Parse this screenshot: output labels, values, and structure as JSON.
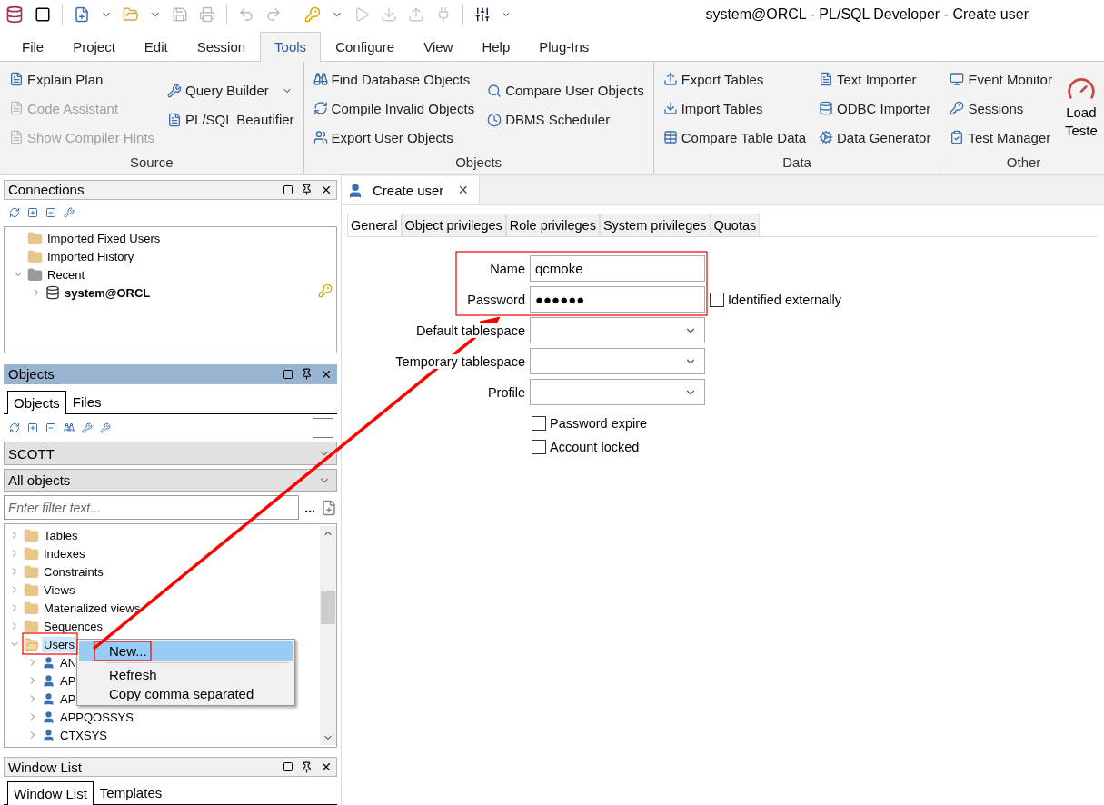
{
  "window": {
    "title": "system@ORCL - PL/SQL Developer - Create user"
  },
  "menu": [
    {
      "label": "File",
      "selected": false
    },
    {
      "label": "Project",
      "selected": false
    },
    {
      "label": "Edit",
      "selected": false
    },
    {
      "label": "Session",
      "selected": false
    },
    {
      "label": "Tools",
      "selected": true
    },
    {
      "label": "Configure",
      "selected": false
    },
    {
      "label": "View",
      "selected": false
    },
    {
      "label": "Help",
      "selected": false
    },
    {
      "label": "Plug-Ins",
      "selected": false
    }
  ],
  "ribbon": [
    {
      "title": "Source",
      "columns": [
        [
          {
            "label": "Explain Plan",
            "disabled": false
          },
          {
            "label": "Code Assistant",
            "disabled": true
          },
          {
            "label": "Show Compiler Hints",
            "disabled": true
          }
        ],
        [
          {
            "label": "Query Builder",
            "disabled": false,
            "dropdown": true
          },
          {
            "label": "PL/SQL Beautifier",
            "disabled": false
          }
        ]
      ]
    },
    {
      "title": "Objects",
      "columns": [
        [
          {
            "label": "Find Database Objects",
            "disabled": false
          },
          {
            "label": "Compile Invalid Objects",
            "disabled": false
          },
          {
            "label": "Export User Objects",
            "disabled": false
          }
        ],
        [
          {
            "label": "Compare User Objects",
            "disabled": false
          },
          {
            "label": "DBMS Scheduler",
            "disabled": false
          }
        ]
      ]
    },
    {
      "title": "Data",
      "columns": [
        [
          {
            "label": "Export Tables",
            "disabled": false
          },
          {
            "label": "Import Tables",
            "disabled": false
          },
          {
            "label": "Compare Table Data",
            "disabled": false
          }
        ],
        [
          {
            "label": "Text Importer",
            "disabled": false
          },
          {
            "label": "ODBC Importer",
            "disabled": false
          },
          {
            "label": "Data Generator",
            "disabled": false
          }
        ]
      ]
    },
    {
      "title": "Other",
      "columns": [
        [
          {
            "label": "Event Monitor",
            "disabled": false
          },
          {
            "label": "Sessions",
            "disabled": false
          },
          {
            "label": "Test Manager",
            "disabled": false
          }
        ]
      ],
      "large": {
        "lines": [
          "Load",
          "Teste"
        ]
      }
    }
  ],
  "connections": {
    "title": "Connections",
    "tree": [
      {
        "label": "Imported Fixed Users",
        "kind": "folder"
      },
      {
        "label": "Imported History",
        "kind": "folder"
      },
      {
        "label": "Recent",
        "kind": "group",
        "expanded": true,
        "children": [
          {
            "label": "system@ORCL",
            "kind": "connection",
            "expanded": false,
            "current": true
          }
        ]
      }
    ]
  },
  "objects": {
    "title": "Objects",
    "tabs": [
      {
        "label": "Objects",
        "selected": true
      },
      {
        "label": "Files",
        "selected": false
      }
    ],
    "schema": "SCOTT",
    "filter": "All objects",
    "search": {
      "placeholder": "Enter filter text..."
    },
    "more": "...",
    "tree": [
      {
        "label": "Tables",
        "expanded": false,
        "selected": false
      },
      {
        "label": "Indexes",
        "expanded": false,
        "selected": false
      },
      {
        "label": "Constraints",
        "expanded": false,
        "selected": false
      },
      {
        "label": "Views",
        "expanded": false,
        "selected": false
      },
      {
        "label": "Materialized views",
        "expanded": false,
        "selected": false
      },
      {
        "label": "Sequences",
        "expanded": false,
        "selected": false
      },
      {
        "label": "Users",
        "expanded": true,
        "selected": true,
        "children": [
          {
            "label": "AN",
            "expanded": false,
            "selected": false
          },
          {
            "label": "AP",
            "expanded": false,
            "selected": false
          },
          {
            "label": "AP",
            "expanded": false,
            "selected": false
          },
          {
            "label": "APPQOSSYS",
            "expanded": false,
            "selected": false
          },
          {
            "label": "CTXSYS",
            "expanded": false,
            "selected": false
          }
        ]
      }
    ]
  },
  "context_menu": [
    {
      "label": "New...",
      "selected": true
    },
    {
      "label": "Refresh",
      "selected": false
    },
    {
      "label": "Copy comma separated",
      "selected": false
    }
  ],
  "window_list": {
    "title": "Window List",
    "tabs": [
      {
        "label": "Window List",
        "selected": true
      },
      {
        "label": "Templates",
        "selected": false
      }
    ]
  },
  "document": {
    "tab": "Create user",
    "close": "×",
    "tabs": [
      {
        "label": "General",
        "selected": true
      },
      {
        "label": "Object privileges",
        "selected": false
      },
      {
        "label": "Role privileges",
        "selected": false
      },
      {
        "label": "System privileges",
        "selected": false
      },
      {
        "label": "Quotas",
        "selected": false
      }
    ],
    "fields": [
      {
        "label": "Name",
        "kind": "text",
        "value": "qcmoke"
      },
      {
        "label": "Password",
        "kind": "text",
        "value": "●●●●●●"
      },
      {
        "label": "Default tablespace",
        "kind": "select"
      },
      {
        "label": "Temporary tablespace",
        "kind": "select"
      },
      {
        "label": "Profile",
        "kind": "select"
      }
    ],
    "identified_externally": {
      "label": "Identified externally",
      "checked": false
    },
    "checkboxes": [
      {
        "label": "Password expire",
        "checked": false
      },
      {
        "label": "Account locked",
        "checked": false
      }
    ]
  }
}
